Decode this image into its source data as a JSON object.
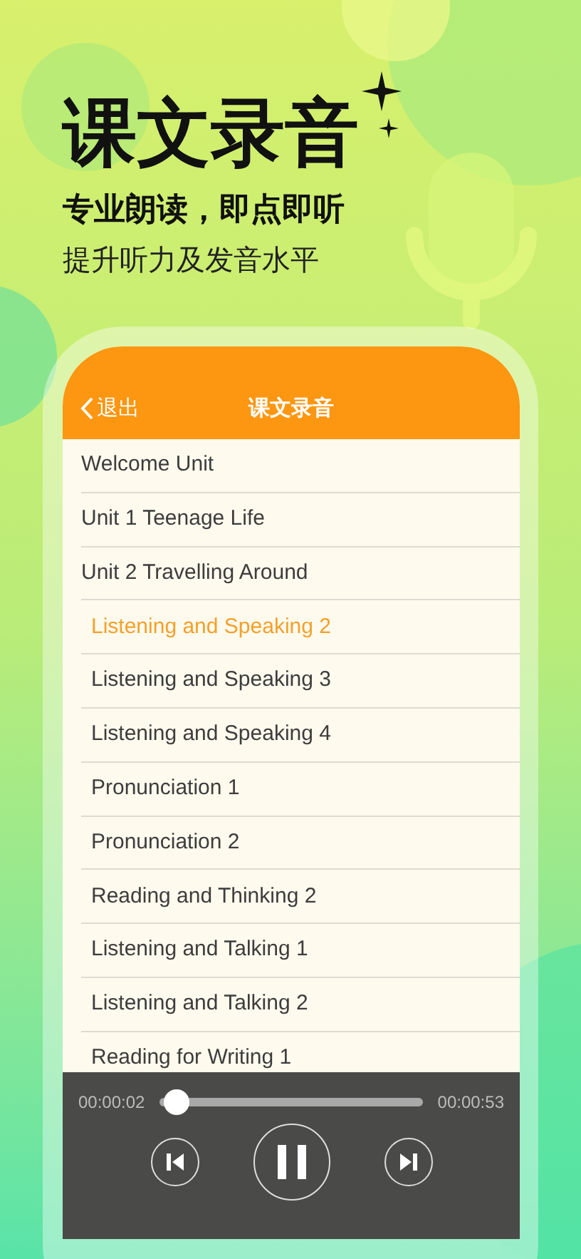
{
  "hero": {
    "title": "课文录音",
    "subtitle": "专业朗读，即点即听",
    "tagline": "提升听力及发音水平"
  },
  "nav": {
    "back": "退出",
    "title": "课文录音"
  },
  "units": [
    {
      "label": "Welcome Unit",
      "selected": false
    },
    {
      "label": "Unit 1 Teenage Life",
      "selected": false
    },
    {
      "label": "Unit 2 Travelling Around",
      "selected": false,
      "children": [
        {
          "label": "Listening and Speaking 2",
          "selected": true
        },
        {
          "label": "Listening and Speaking 3",
          "selected": false
        },
        {
          "label": "Listening and Speaking 4",
          "selected": false
        },
        {
          "label": "Pronunciation 1",
          "selected": false
        },
        {
          "label": "Pronunciation 2",
          "selected": false
        },
        {
          "label": "Reading and Thinking 2",
          "selected": false
        },
        {
          "label": "Listening and Talking 1",
          "selected": false
        },
        {
          "label": "Listening and Talking 2",
          "selected": false
        },
        {
          "label": "Reading for Writing 1",
          "selected": false
        }
      ]
    }
  ],
  "player": {
    "elapsed": "00:00:02",
    "total": "00:00:53",
    "level": 0.04,
    "playing": true
  }
}
